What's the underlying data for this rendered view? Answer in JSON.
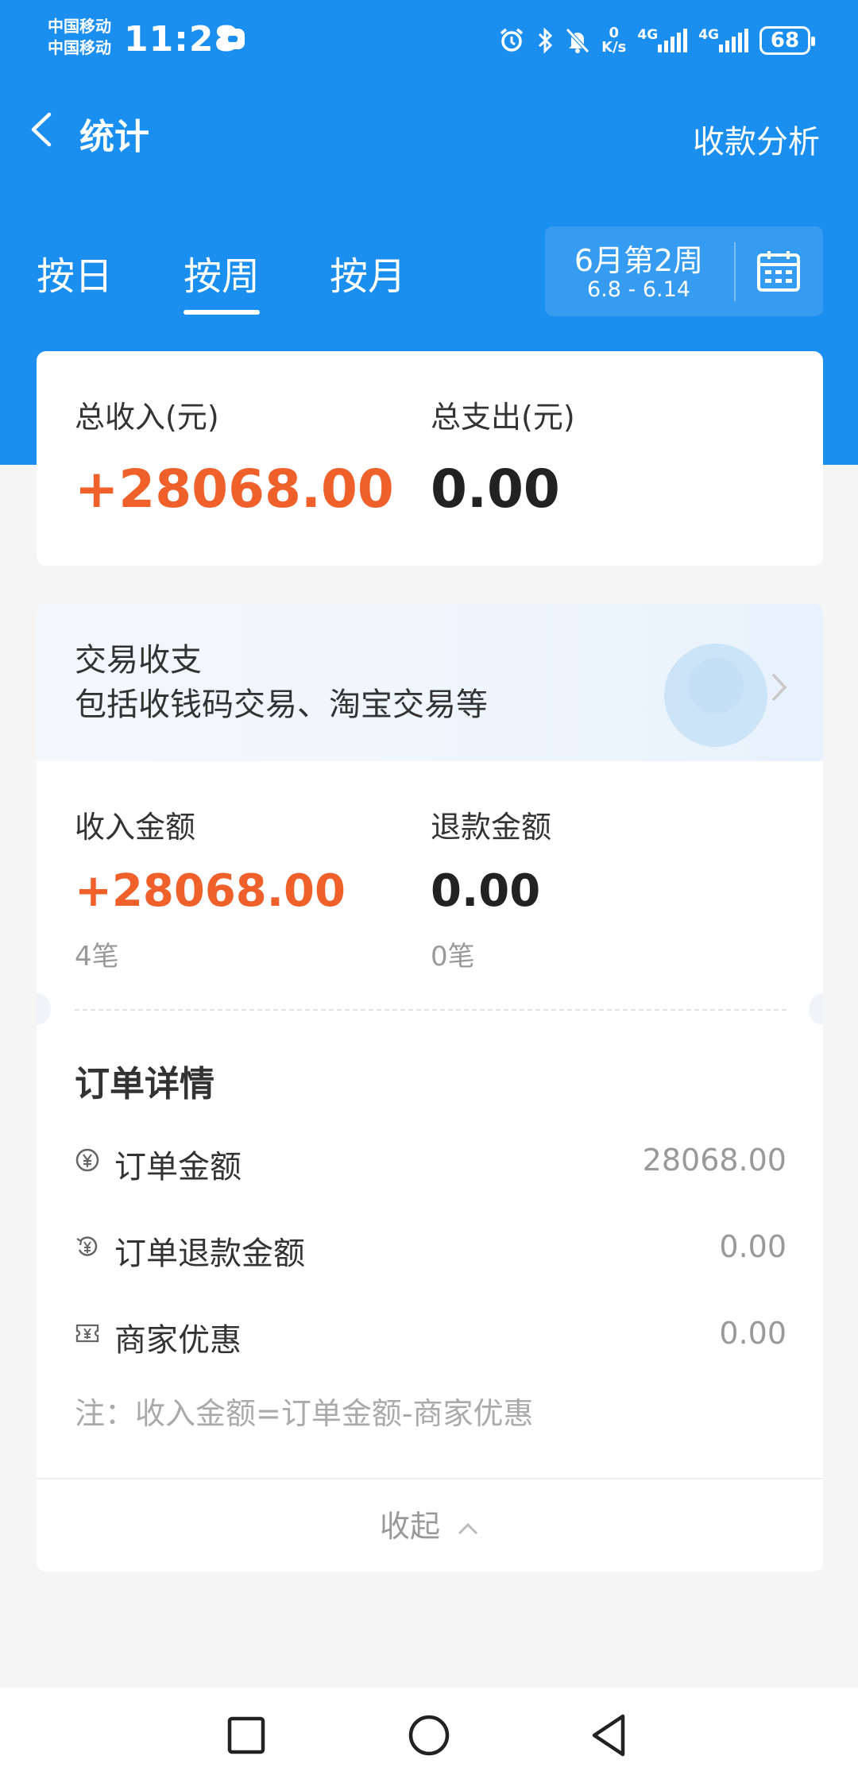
{
  "status_bar": {
    "carrier_1": "中国移动",
    "carrier_2": "中国移动",
    "time": "11:28",
    "speed_value": "0",
    "speed_unit": "K/s",
    "network_1": "4G",
    "network_2": "4G",
    "battery": "68"
  },
  "header": {
    "title": "统计",
    "right_link": "收款分析"
  },
  "tabs": [
    {
      "label": "按日",
      "active": false
    },
    {
      "label": "按周",
      "active": true
    },
    {
      "label": "按月",
      "active": false
    }
  ],
  "week_picker": {
    "title": "6月第2周",
    "range": "6.8 - 6.14"
  },
  "summary": {
    "income_label": "总收入(元)",
    "income_value": "+28068.00",
    "expense_label": "总支出(元)",
    "expense_value": "0.00"
  },
  "transactions": {
    "title": "交易收支",
    "subtitle": "包括收钱码交易、淘宝交易等",
    "income_label": "收入金额",
    "income_value": "+28068.00",
    "income_count": "4笔",
    "refund_label": "退款金额",
    "refund_value": "0.00",
    "refund_count": "0笔"
  },
  "order_details": {
    "title": "订单详情",
    "rows": [
      {
        "label": "订单金额",
        "value": "28068.00",
        "icon": "yuan-circle-icon"
      },
      {
        "label": "订单退款金额",
        "value": "0.00",
        "icon": "refund-icon"
      },
      {
        "label": "商家优惠",
        "value": "0.00",
        "icon": "coupon-icon"
      }
    ],
    "note": "注：收入金额=订单金额-商家优惠",
    "collapse_label": "收起"
  },
  "colors": {
    "primary_blue": "#1a8ff0",
    "income_orange": "#f0602a"
  }
}
